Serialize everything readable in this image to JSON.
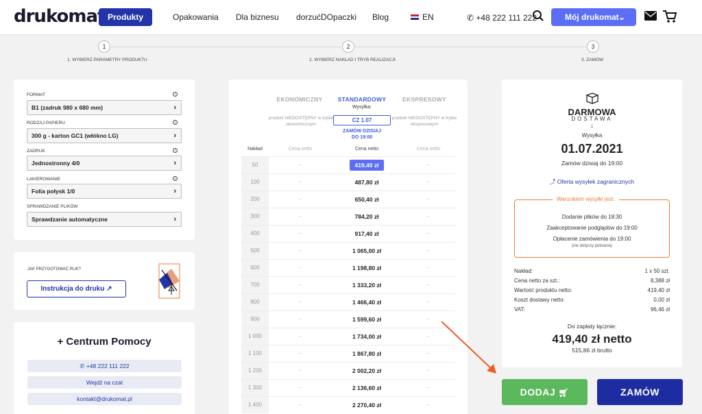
{
  "header": {
    "logo": "drukomat.",
    "nav": [
      "Produkty",
      "Opakowania",
      "Dla biznesu",
      "dorzućDOpaczki",
      "Blog"
    ],
    "lang": "EN",
    "phone": "+48 222 111 222",
    "my_account": "Mój drukomat"
  },
  "steps": [
    {
      "num": "1",
      "label": "1. WYBIERZ PARAMETRY PRODUKTU"
    },
    {
      "num": "2",
      "label": "2. WYBIERZ NAKŁAD I TRYB REALIZACJI"
    },
    {
      "num": "3",
      "label": "3. ZAMÓW"
    }
  ],
  "params": [
    {
      "label": "FORMAT",
      "value": "B1 (zadruk 980 x 680 mm)",
      "info": true
    },
    {
      "label": "RODZAJ PAPIERU",
      "value": "300 g - karton GC1 (włókno LG)",
      "info": true
    },
    {
      "label": "ZADRUK",
      "value": "Jednostronny 4/0",
      "info": true
    },
    {
      "label": "LAKIEROWANIE",
      "value": "Folia połysk 1/0",
      "info": true
    },
    {
      "label": "SPRAWDZANIE PLIKÓW",
      "value": "Sprawdzanie automatyczne",
      "info": false
    }
  ],
  "prepare": {
    "question": "JAK PRZYGOTOWAĆ PLIK?",
    "button": "Instrukcja do druku"
  },
  "help": {
    "title": "+ Centrum Pomocy",
    "phone": "+48 222 111 222",
    "chat": "Wejdź na czat",
    "email": "kontakt@drukomat.pl"
  },
  "modes": {
    "economy": {
      "title": "EKONOMICZNY",
      "note": "produkt NIEDOSTĘPNY w trybie ekonomicznym"
    },
    "standard": {
      "title": "STANDARDOWY",
      "shipping_label": "Wysyłka:",
      "date": "CZ 1.07",
      "order_today": "ZAMÓW DZISIAJ",
      "until": "DO 19:00"
    },
    "express": {
      "title": "EKSPRESOWY",
      "note": "produkt NIEDOSTĘPNY w trybie ekspresowym"
    }
  },
  "table": {
    "col_qty": "Nakład",
    "col_price": "Cena netto",
    "dash": "–",
    "rows": [
      {
        "qty": "50",
        "price": "419,40 zł"
      },
      {
        "qty": "100",
        "price": "487,80 zł"
      },
      {
        "qty": "200",
        "price": "650,40 zł"
      },
      {
        "qty": "300",
        "price": "784,20 zł"
      },
      {
        "qty": "400",
        "price": "917,40 zł"
      },
      {
        "qty": "500",
        "price": "1 065,00 zł"
      },
      {
        "qty": "600",
        "price": "1 198,80 zł"
      },
      {
        "qty": "700",
        "price": "1 333,20 zł"
      },
      {
        "qty": "800",
        "price": "1 466,40 zł"
      },
      {
        "qty": "900",
        "price": "1 599,60 zł"
      },
      {
        "qty": "1 000",
        "price": "1 734,00 zł"
      },
      {
        "qty": "1 100",
        "price": "1 867,80 zł"
      },
      {
        "qty": "1 200",
        "price": "2 002,20 zł"
      },
      {
        "qty": "1 300",
        "price": "2 136,60 zł"
      },
      {
        "qty": "1 400",
        "price": "2 270,40 zł"
      }
    ]
  },
  "summary": {
    "free": "DARMOWA",
    "delivery": "DOSTAWA",
    "arrow": "↓",
    "shipping": "Wysyłka",
    "date": "01.07.2021",
    "order_until": "Zamów dzisiaj do 19:00",
    "foreign_link": "Oferta wysyłek zagranicznych",
    "cond_title": "Warunkiem wysyłki jest:",
    "cond_1": "Dodanie plików do 18:30",
    "cond_2": "Zaakceptowanie podglądów do 19:00",
    "cond_3": "Opłacenie zamówienia do 19:00",
    "cond_note": "(nie dotyczy pobrania)",
    "rows": [
      {
        "label": "Nakład:",
        "value": "1 x 50 szt."
      },
      {
        "label": "Cena netto za szt.:",
        "value": "8,388 zł"
      },
      {
        "label": "Wartość produktu netto:",
        "value": "419,40 zł"
      },
      {
        "label": "Koszt dostawy netto:",
        "value": "0,00 zł"
      },
      {
        "label": "VAT:",
        "value": "96,46 zł"
      }
    ],
    "total_label": "Do zapłaty łącznie:",
    "total_net": "419,40 zł netto",
    "total_gross": "515,86 zł brutto"
  },
  "actions": {
    "add": "DODAJ",
    "order": "ZAMÓW"
  },
  "colors": {
    "primary": "#2334a8",
    "accent": "#5b6ef5",
    "add": "#5cb85c",
    "orange": "#f07a3a"
  }
}
